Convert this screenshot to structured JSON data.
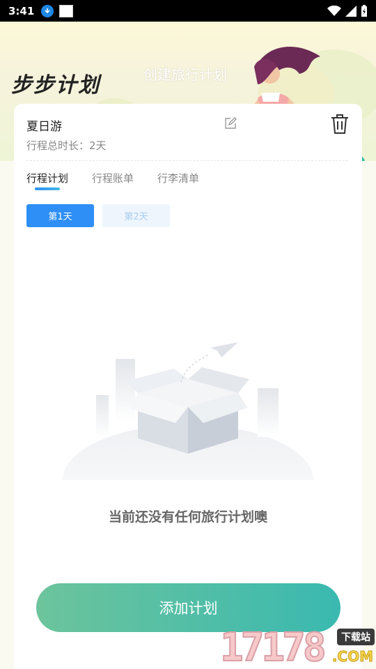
{
  "status_bar": {
    "time": "3:41"
  },
  "header": {
    "logo_text": "步步计划",
    "subtitle": "创建旅行计划"
  },
  "trip": {
    "name": "夏日游",
    "duration": "行程总时长：2天"
  },
  "tabs": [
    {
      "label": "行程计划",
      "active": true
    },
    {
      "label": "行程账单",
      "active": false
    },
    {
      "label": "行李清单",
      "active": false
    }
  ],
  "days": [
    {
      "label": "第1天",
      "active": true
    },
    {
      "label": "第2天",
      "active": false
    }
  ],
  "empty_state": {
    "message": "当前还没有任何旅行计划噢"
  },
  "actions": {
    "add_plan": "添加计划"
  },
  "watermark": {
    "number": "17178",
    "tag": "下载站",
    "domain": ".COM"
  },
  "colors": {
    "accent_blue": "#2e8ff6",
    "button_gradient_start": "#6cc49c",
    "button_gradient_end": "#3ab9b0",
    "background": "#fbfaf0"
  }
}
